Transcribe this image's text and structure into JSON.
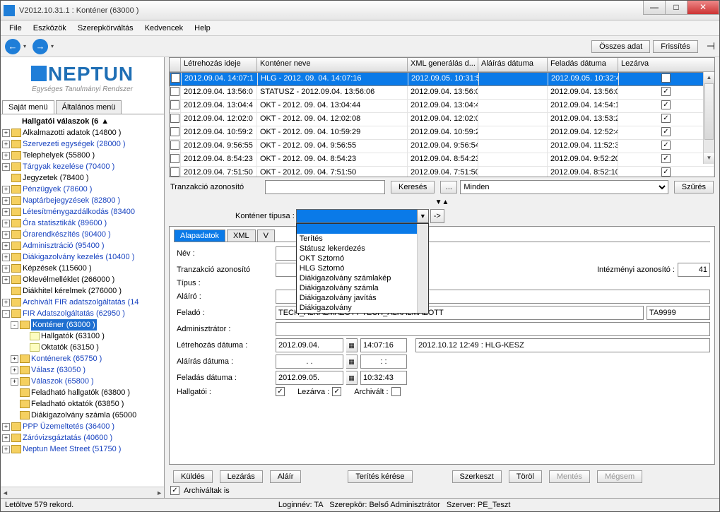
{
  "title": "V2012.10.31.1 : Konténer (63000  )",
  "menu": [
    "File",
    "Eszközök",
    "Szerepkörváltás",
    "Kedvencek",
    "Help"
  ],
  "top_buttons": {
    "osszes": "Összes adat",
    "frissites": "Frissítés"
  },
  "logo": {
    "main": "NEPTUN",
    "sub": "Egységes Tanulmányi Rendszer"
  },
  "left_tabs": {
    "sajat": "Saját menü",
    "altalanos": "Általános menü"
  },
  "tree_root": "Hallgatói válaszok (6",
  "tree": [
    {
      "l": "Alkalmazotti adatok (14800  )",
      "e": "+",
      "c": "black",
      "in": 0
    },
    {
      "l": "Szervezeti egységek (28000  )",
      "e": "+",
      "c": "blue",
      "in": 0
    },
    {
      "l": "Telephelyek (55800  )",
      "e": "+",
      "c": "black",
      "in": 0
    },
    {
      "l": "Tárgyak kezelése (70400  )",
      "e": "+",
      "c": "blue",
      "in": 0
    },
    {
      "l": "Jegyzetek (78400  )",
      "e": "",
      "c": "black",
      "in": 0
    },
    {
      "l": "Pénzügyek (78600  )",
      "e": "+",
      "c": "blue",
      "in": 0
    },
    {
      "l": "Naptárbejegyzések (82800  )",
      "e": "+",
      "c": "blue",
      "in": 0
    },
    {
      "l": "Létesítménygazdálkodás (83400",
      "e": "+",
      "c": "blue",
      "in": 0
    },
    {
      "l": "Óra statisztikák (89600  )",
      "e": "+",
      "c": "blue",
      "in": 0
    },
    {
      "l": "Órarendkészítés (90400  )",
      "e": "+",
      "c": "blue",
      "in": 0
    },
    {
      "l": "Adminisztráció (95400  )",
      "e": "+",
      "c": "blue",
      "in": 0
    },
    {
      "l": "Diákigazolvány kezelés (10400  )",
      "e": "+",
      "c": "blue",
      "in": 0
    },
    {
      "l": "Képzések (115600  )",
      "e": "+",
      "c": "black",
      "in": 0
    },
    {
      "l": "Oklevélmelléklet (266000  )",
      "e": "+",
      "c": "black",
      "in": 0
    },
    {
      "l": "Diákhitel kérelmek (276000  )",
      "e": " ",
      "c": "black",
      "in": 0
    },
    {
      "l": "Archivált FIR adatszolgáltatás (14",
      "e": "+",
      "c": "blue",
      "in": 0
    },
    {
      "l": "FIR Adatszolgáltatás (62950  )",
      "e": "-",
      "c": "blue",
      "in": 0
    },
    {
      "l": "Konténer (63000  )",
      "e": "-",
      "c": "sel",
      "in": 1,
      "sel": true
    },
    {
      "l": "Hallgatók (63100  )",
      "e": " ",
      "c": "black",
      "in": 2,
      "p": true
    },
    {
      "l": "Oktatók (63150  )",
      "e": " ",
      "c": "black",
      "in": 2,
      "p": true
    },
    {
      "l": "Konténerek (65750  )",
      "e": "+",
      "c": "blue",
      "in": 1
    },
    {
      "l": "Válasz (63050  )",
      "e": "+",
      "c": "blue",
      "in": 1
    },
    {
      "l": "Válaszok (65800  )",
      "e": "+",
      "c": "blue",
      "in": 1
    },
    {
      "l": "Feladható hallgatók (63800  )",
      "e": " ",
      "c": "black",
      "in": 1
    },
    {
      "l": "Feladható oktatók (63850  )",
      "e": " ",
      "c": "black",
      "in": 1
    },
    {
      "l": "Diákigazolvány számla (65000",
      "e": " ",
      "c": "black",
      "in": 1
    },
    {
      "l": "PPP Üzemeltetés (36400  )",
      "e": "+",
      "c": "blue",
      "in": 0
    },
    {
      "l": "Záróvizsgáztatás (40600  )",
      "e": "+",
      "c": "blue",
      "in": 0
    },
    {
      "l": "Neptun Meet Street (51750  )",
      "e": "+",
      "c": "blue",
      "in": 0
    }
  ],
  "grid": {
    "headers": [
      "",
      "Létrehozás ideje",
      "Konténer neve",
      "XML generálás d...",
      "Aláírás dátuma",
      "Feladás dátuma",
      "Lezárva"
    ],
    "rows": [
      {
        "c": [
          "2012.09.04. 14:07:1",
          "HLG - 2012. 09. 04. 14:07:16",
          "2012.09.05. 10:31:5",
          "",
          "2012.09.05. 10:32:4"
        ],
        "sel": true,
        "chk": true
      },
      {
        "c": [
          "2012.09.04. 13:56:0",
          "STATUSZ - 2012.09.04. 13:56:06",
          "2012.09.04. 13:56:0",
          "",
          "2012.09.04. 13:56:0"
        ],
        "chk": true
      },
      {
        "c": [
          "2012.09.04. 13:04:4",
          "OKT - 2012. 09. 04. 13:04:44",
          "2012.09.04. 13:04:4",
          "",
          "2012.09.04. 14:54:1"
        ],
        "chk": true
      },
      {
        "c": [
          "2012.09.04. 12:02:0",
          "OKT - 2012. 09. 04. 12:02:08",
          "2012.09.04. 12:02:0",
          "",
          "2012.09.04. 13:53:2"
        ],
        "chk": true
      },
      {
        "c": [
          "2012.09.04. 10:59:2",
          "OKT - 2012. 09. 04. 10:59:29",
          "2012.09.04. 10:59:2",
          "",
          "2012.09.04. 12:52:4"
        ],
        "chk": true
      },
      {
        "c": [
          "2012.09.04. 9:56:55",
          "OKT - 2012. 09. 04. 9:56:55",
          "2012.09.04. 9:56:54",
          "",
          "2012.09.04. 11:52:3"
        ],
        "chk": true
      },
      {
        "c": [
          "2012.09.04. 8:54:23",
          "OKT - 2012. 09. 04. 8:54:23",
          "2012.09.04. 8:54:23",
          "",
          "2012.09.04. 9:52:20"
        ],
        "chk": true
      },
      {
        "c": [
          "2012.09.04. 7:51:50",
          "OKT - 2012. 09. 04. 7:51:50",
          "2012.09.04. 7:51:50",
          "",
          "2012.09.04. 8:52:10"
        ],
        "chk": true
      }
    ]
  },
  "search": {
    "label": "Tranzakció azonosító",
    "btn": "Keresés",
    "dots": "...",
    "combo": "Minden",
    "filter": "Szűrés"
  },
  "type_label": "Konténer típusa :",
  "type_value": "",
  "combo_items": [
    "",
    "Terítés",
    "Státusz lekerdezés",
    "OKT Sztornó",
    "HLG Sztornó",
    "Diákigazolvány számlakép",
    "Diákigazolvány számla",
    "Diákigazolvány javítás",
    "Diákigazolvány"
  ],
  "dtabs": [
    "Alapadatok",
    "XML",
    "V"
  ],
  "form": {
    "nev": "Név :",
    "tranz": "Tranzakció azonosító",
    "tipus": "Típus :",
    "alairo": "Aláíró :",
    "felado": "Feladó :",
    "felado_v": "TECH_ALKALMAZOTT TECH_ALKALMAZOTT",
    "felado_code": "TA9999",
    "admin": "Adminisztrátor :",
    "letre": "Létrehozás dátuma :",
    "letre_d": "2012.09.04.",
    "letre_t": "14:07:16",
    "alairas": "Aláírás dátuma :",
    "alairas_d": ". .",
    "alairas_t": ":  :",
    "feladas": "Feladás dátuma :",
    "feladas_d": "2012.09.05.",
    "feladas_t": "10:32:43",
    "intezmeny": "Intézményi azonosító :",
    "intezmeny_v": "41",
    "note": "2012.10.12 12:49 : HLG-KESZ",
    "hallgatoi": "Hallgatói :",
    "lezarva": "Lezárva :",
    "archivalt": "Archivált :"
  },
  "btns": {
    "kuldes": "Küldés",
    "lezaras": "Lezárás",
    "alair": "Aláír",
    "terites": "Terítés kérése",
    "szerkeszt": "Szerkeszt",
    "torol": "Töröl",
    "mentes": "Mentés",
    "megsem": "Mégsem",
    "archchk": "Archiváltak is"
  },
  "status": {
    "left": "Letöltve 579 rekord.",
    "login": "Loginnév: TA",
    "szerep": "Szerepkör: Belső Adminisztrátor",
    "szerver": "Szerver: PE_Teszt"
  }
}
